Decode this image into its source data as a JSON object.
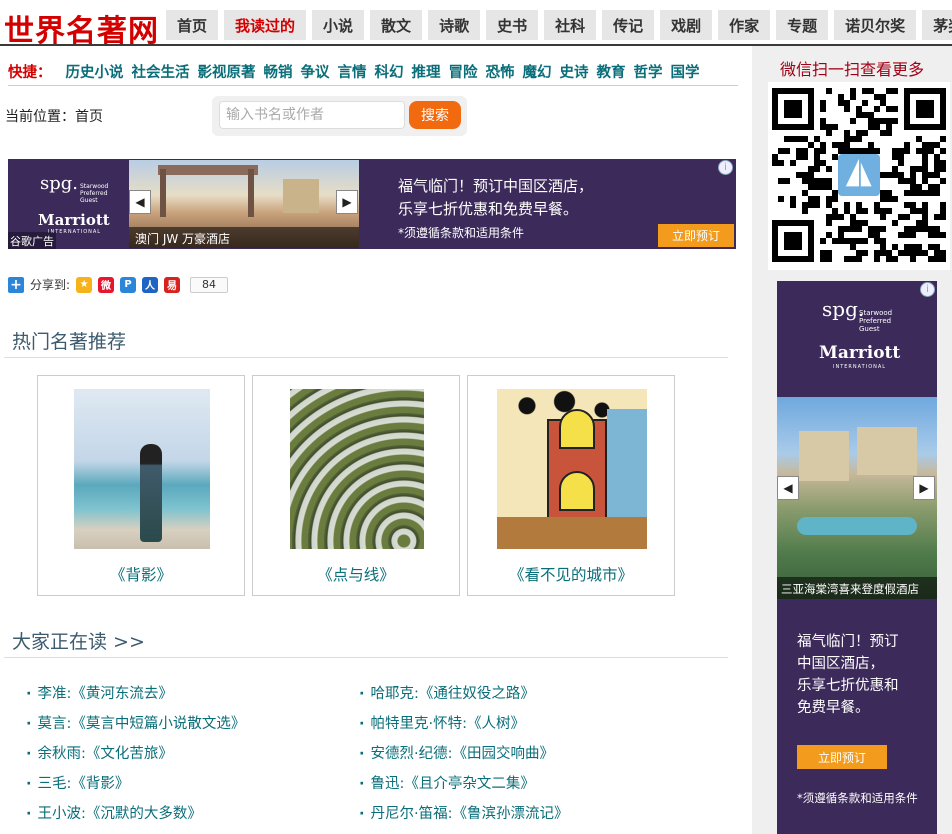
{
  "site": {
    "logo": "世界名著网"
  },
  "nav": [
    {
      "label": "首页",
      "active": false
    },
    {
      "label": "我读过的",
      "active": true
    },
    {
      "label": "小说",
      "active": false
    },
    {
      "label": "散文",
      "active": false
    },
    {
      "label": "诗歌",
      "active": false
    },
    {
      "label": "史书",
      "active": false
    },
    {
      "label": "社科",
      "active": false
    },
    {
      "label": "传记",
      "active": false
    },
    {
      "label": "戏剧",
      "active": false
    },
    {
      "label": "作家",
      "active": false
    },
    {
      "label": "专题",
      "active": false
    },
    {
      "label": "诺贝尔奖",
      "active": false
    },
    {
      "label": "茅奖",
      "active": false
    }
  ],
  "quick": {
    "label": "快捷：",
    "links": [
      "历史小说",
      "社会生活",
      "影视原著",
      "畅销",
      "争议",
      "言情",
      "科幻",
      "推理",
      "冒险",
      "恐怖",
      "魔幻",
      "史诗",
      "教育",
      "哲学",
      "国学"
    ]
  },
  "location": "当前位置：首页",
  "search": {
    "placeholder": "输入书名或作者",
    "value": "",
    "button": "搜索"
  },
  "ad_banner": {
    "brand": "spg.",
    "brand_sub": [
      "Starwood",
      "Preferred",
      "Guest"
    ],
    "marriott": "Marriott",
    "marriott_sub": "INTERNATIONAL",
    "caption": "澳门 JW 万豪酒店",
    "tag": "谷歌广告",
    "message_line1": "福气临门！预订中国区酒店，",
    "message_line2": "乐享七折优惠和免费早餐。",
    "note": "*须遵循条款和适用条件",
    "cta": "立即预订",
    "info": "i"
  },
  "share": {
    "label": "分享到:",
    "count": "84",
    "icons": [
      {
        "name": "qzone-icon",
        "color": "#f5b21b",
        "glyph": "★"
      },
      {
        "name": "weibo-icon",
        "color": "#e6162d",
        "glyph": "微"
      },
      {
        "name": "tencent-weibo-icon",
        "color": "#2b86d9",
        "glyph": "P"
      },
      {
        "name": "renren-icon",
        "color": "#1f64c2",
        "glyph": "人"
      },
      {
        "name": "netease-icon",
        "color": "#d7231e",
        "glyph": "易"
      }
    ]
  },
  "hot": {
    "title": "热门名著推荐",
    "books": [
      {
        "title": "《背影》"
      },
      {
        "title": "《点与线》"
      },
      {
        "title": "《看不见的城市》"
      }
    ]
  },
  "reading": {
    "title": "大家正在读 >>",
    "left": [
      "李准:《黄河东流去》",
      "莫言:《莫言中短篇小说散文选》",
      "余秋雨:《文化苦旅》",
      "三毛:《背影》",
      "王小波:《沉默的大多数》"
    ],
    "right": [
      "哈耶克:《通往奴役之路》",
      "帕特里克·怀特:《人树》",
      "安德烈·纪德:《田园交响曲》",
      "鲁迅:《且介亭杂文二集》",
      "丹尼尔·笛福:《鲁滨孙漂流记》"
    ]
  },
  "sidebar": {
    "wechat_title": "微信扫一扫查看更多"
  },
  "ad_side": {
    "brand": "spg.",
    "brand_sub": [
      "Starwood",
      "Preferred",
      "Guest"
    ],
    "marriott": "Marriott",
    "marriott_sub": "INTERNATIONAL",
    "caption": "三亚海棠湾喜来登度假酒店",
    "message": [
      "福气临门！预订",
      "中国区酒店，",
      "乐享七折优惠和",
      "免费早餐。"
    ],
    "cta": "立即预订",
    "note": "*须遵循条款和适用条件",
    "info": "i"
  },
  "colors": {
    "brand_red": "#d40000",
    "link_teal": "#0a6e7a",
    "ad_purple": "#3b2a5a",
    "cta_orange": "#f29b1d",
    "search_orange": "#f26a10"
  }
}
